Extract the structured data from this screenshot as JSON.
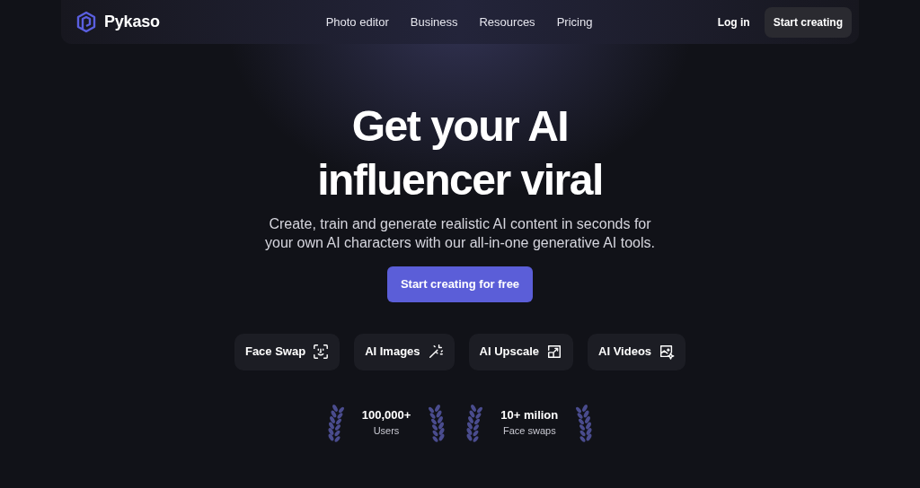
{
  "brand": {
    "name": "Pykaso"
  },
  "nav_links": [
    "Photo editor",
    "Business",
    "Resources",
    "Pricing"
  ],
  "nav_actions": {
    "login": "Log in",
    "cta": "Start creating"
  },
  "hero": {
    "title_lines": [
      "Get your AI",
      "influencer viral"
    ],
    "subtitle": "Create, train and generate realistic AI content in seconds for your own AI characters with our all-in-one generative AI tools.",
    "cta": "Start creating for free"
  },
  "features": [
    {
      "label": "Face Swap",
      "kind": "face"
    },
    {
      "label": "AI Images",
      "kind": "wand"
    },
    {
      "label": "AI Upscale",
      "kind": "upscale"
    },
    {
      "label": "AI Videos",
      "kind": "video"
    }
  ],
  "stats": [
    {
      "value": "100,000+",
      "label": "Users"
    },
    {
      "value": "10+ milion",
      "label": "Face swaps"
    }
  ]
}
